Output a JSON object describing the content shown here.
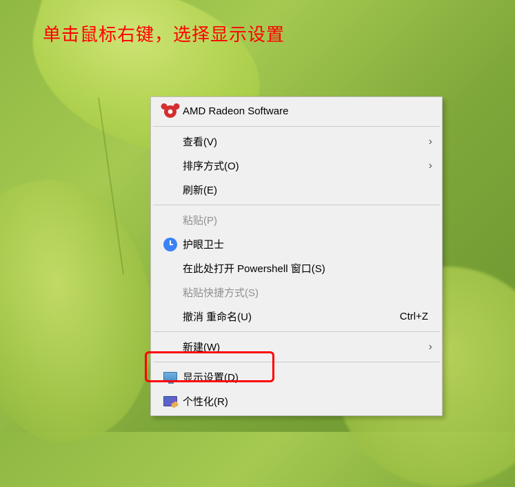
{
  "instruction": "单击鼠标右键，选择显示设置",
  "menu": {
    "amd": "AMD Radeon Software",
    "view": "查看(V)",
    "sort": "排序方式(O)",
    "refresh": "刷新(E)",
    "paste": "粘贴(P)",
    "eyeguard": "护眼卫士",
    "powershell": "在此处打开 Powershell 窗口(S)",
    "paste_shortcut": "粘贴快捷方式(S)",
    "undo": "撤消 重命名(U)",
    "undo_shortcut": "Ctrl+Z",
    "new": "新建(W)",
    "display": "显示设置(D)",
    "personalize": "个性化(R)"
  }
}
